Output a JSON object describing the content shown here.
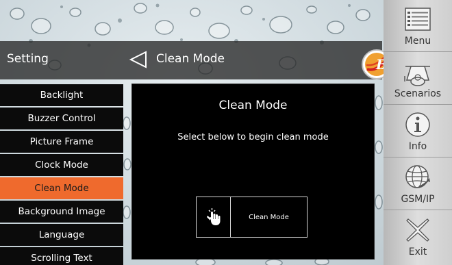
{
  "header": {
    "section_title": "Setting",
    "page_title": "Clean Mode"
  },
  "menu": {
    "items": [
      {
        "label": "Backlight",
        "active": false
      },
      {
        "label": "Buzzer Control",
        "active": false
      },
      {
        "label": "Picture Frame",
        "active": false
      },
      {
        "label": "Clock Mode",
        "active": false
      },
      {
        "label": "Clean Mode",
        "active": true
      },
      {
        "label": "Background Image",
        "active": false
      },
      {
        "label": "Language",
        "active": false
      },
      {
        "label": "Scrolling Text",
        "active": false
      }
    ]
  },
  "dialog": {
    "title": "Clean Mode",
    "instruction": "Select below to begin clean mode",
    "button_label": "Clean Mode"
  },
  "sidebar": {
    "buttons": [
      {
        "label": "Menu",
        "icon": "menu-icon"
      },
      {
        "label": "Scenarios",
        "icon": "scenarios-icon"
      },
      {
        "label": "Info",
        "icon": "info-icon"
      },
      {
        "label": "GSM/IP",
        "icon": "globe-icon"
      },
      {
        "label": "Exit",
        "icon": "exit-icon"
      }
    ]
  },
  "colors": {
    "active_menu": "#ef6a2d",
    "menu_bg": "#0b0b0b",
    "dialog_bg": "#000000",
    "header_bg": "#282828"
  }
}
